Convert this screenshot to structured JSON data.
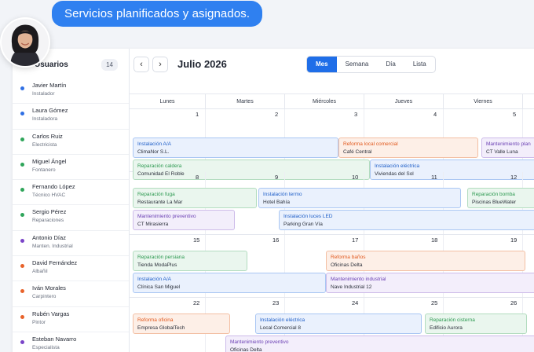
{
  "chat": {
    "message": "Servicios planificados y asignados."
  },
  "sidebar": {
    "title": "Usuarios",
    "count": "14",
    "users": [
      {
        "name": "Javier Martín",
        "role": "Instalador",
        "color": "#2f6fe4"
      },
      {
        "name": "Laura Gómez",
        "role": "Instaladora",
        "color": "#2f6fe4"
      },
      {
        "name": "Carlos Ruiz",
        "role": "Electricista",
        "color": "#2fa55a"
      },
      {
        "name": "Miguel Ángel",
        "role": "Fontanero",
        "color": "#2fa55a"
      },
      {
        "name": "Fernando López",
        "role": "Técnico HVAC",
        "color": "#2fa55a"
      },
      {
        "name": "Sergio Pérez",
        "role": "Reparaciones",
        "color": "#2fa55a"
      },
      {
        "name": "Antonio Díaz",
        "role": "Manten. Industrial",
        "color": "#7a44c8"
      },
      {
        "name": "David Fernández",
        "role": "Albañil",
        "color": "#e8622a"
      },
      {
        "name": "Iván Morales",
        "role": "Carpintero",
        "color": "#e8622a"
      },
      {
        "name": "Rubén Vargas",
        "role": "Pintor",
        "color": "#e8622a"
      },
      {
        "name": "Esteban Navarro",
        "role": "Especialista",
        "color": "#7a44c8"
      }
    ]
  },
  "toolbar": {
    "prev_icon": "‹",
    "next_icon": "›",
    "month": "Julio 2026",
    "views": [
      "Mes",
      "Semana",
      "Día",
      "Lista"
    ],
    "active_view": "Mes"
  },
  "calendar": {
    "days": [
      "Lunes",
      "Martes",
      "Miércoles",
      "Jueves",
      "Viernes",
      ""
    ],
    "weeks": [
      {
        "dates": [
          "1",
          "2",
          "3",
          "4",
          "5",
          ""
        ],
        "events": [
          {
            "title": "Instalación A/A",
            "client": "ClimaNor S.L.",
            "color": "blue"
          },
          {
            "title": "Reforma local comercial",
            "client": "Café Central",
            "color": "orange"
          },
          {
            "title": "Mantenimiento plan",
            "client": "CT Valle Luna",
            "color": "purple"
          },
          {
            "title": "Reparación caldera",
            "client": "Comunidad El Roble",
            "color": "green"
          },
          {
            "title": "Instalación eléctrica",
            "client": "Viviendas del Sol",
            "color": "blue"
          }
        ]
      },
      {
        "dates": [
          "8",
          "9",
          "10",
          "11",
          "12",
          ""
        ],
        "events": [
          {
            "title": "Reparación fuga",
            "client": "Restaurante La Mar",
            "color": "green"
          },
          {
            "title": "Instalación termo",
            "client": "Hotel Bahía",
            "color": "blue"
          },
          {
            "title": "Reparación bomba",
            "client": "Piscinas BlueWater",
            "color": "green"
          },
          {
            "title": "Mantenimiento preventivo",
            "client": "CT Mirasierra",
            "color": "purple"
          },
          {
            "title": "Instalación luces LED",
            "client": "Parking Gran Vía",
            "color": "blue"
          }
        ]
      },
      {
        "dates": [
          "15",
          "16",
          "17",
          "18",
          "19",
          ""
        ],
        "events": [
          {
            "title": "Reparación persiana",
            "client": "Tienda ModaPlus",
            "color": "green"
          },
          {
            "title": "Reforma baños",
            "client": "Oficinas Delta",
            "color": "orange"
          },
          {
            "title": "Instalación A/A",
            "client": "Clínica San Miguel",
            "color": "blue"
          },
          {
            "title": "Mantenimiento industrial",
            "client": "Nave Industrial 12",
            "color": "purple"
          }
        ]
      },
      {
        "dates": [
          "22",
          "23",
          "24",
          "25",
          "26",
          ""
        ],
        "events": [
          {
            "title": "Reforma oficina",
            "client": "Empresa GlobalTech",
            "color": "orange"
          },
          {
            "title": "Instalación eléctrica",
            "client": "Local Comercial 8",
            "color": "blue"
          },
          {
            "title": "Reparación cisterna",
            "client": "Edificio Aurora",
            "color": "green"
          },
          {
            "title": "Mantenimiento preventivo",
            "client": "Oficinas Delta",
            "color": "purple"
          }
        ]
      }
    ]
  }
}
